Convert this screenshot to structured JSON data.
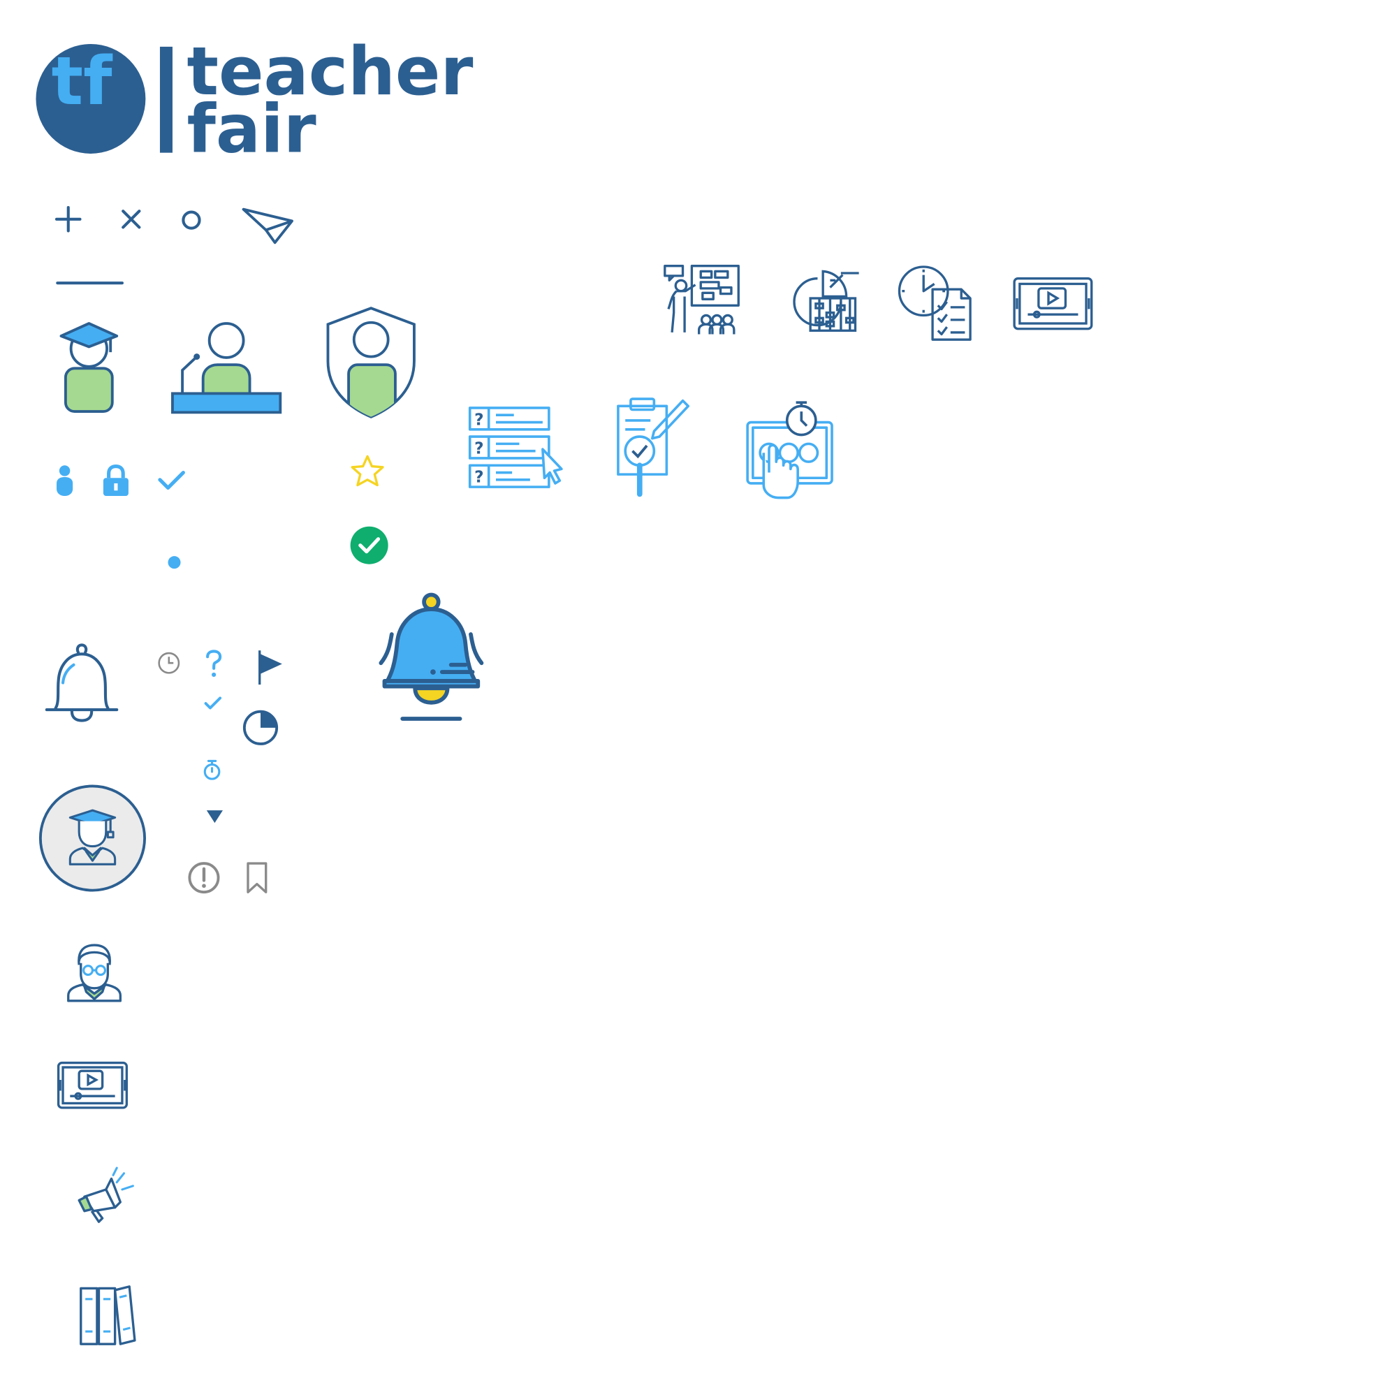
{
  "logo": {
    "monogram": "tf",
    "word_line1": "teacher",
    "word_line2": "fair"
  },
  "colors": {
    "navy": "#2C5F91",
    "blue": "#45AEF3",
    "green": "#A5D991",
    "yellow": "#F5D422",
    "success": "#0FAE6E",
    "grey": "#8A8A8A"
  },
  "icons": [
    "plus-icon",
    "close-icon",
    "circle-icon",
    "paper-plane-icon",
    "minus-icon",
    "graduate-icon",
    "speaker-podium-icon",
    "shield-user-icon",
    "teacher-board-icon",
    "analytics-abacus-icon",
    "clock-checklist-icon",
    "video-tablet-icon",
    "quiz-list-icon",
    "clipboard-search-icon",
    "touch-timer-icon",
    "user-small-icon",
    "lock-icon",
    "check-icon",
    "star-icon",
    "success-check-icon",
    "dot-icon",
    "bell-outline-icon",
    "clock-small-icon",
    "question-icon",
    "flag-icon",
    "check-small-icon",
    "pie-progress-icon",
    "stopwatch-icon",
    "ringing-bell-icon",
    "graduate-avatar-icon",
    "caret-down-icon",
    "alert-icon",
    "bookmark-icon",
    "student-glasses-icon",
    "video-player-icon",
    "megaphone-icon",
    "books-icon"
  ]
}
